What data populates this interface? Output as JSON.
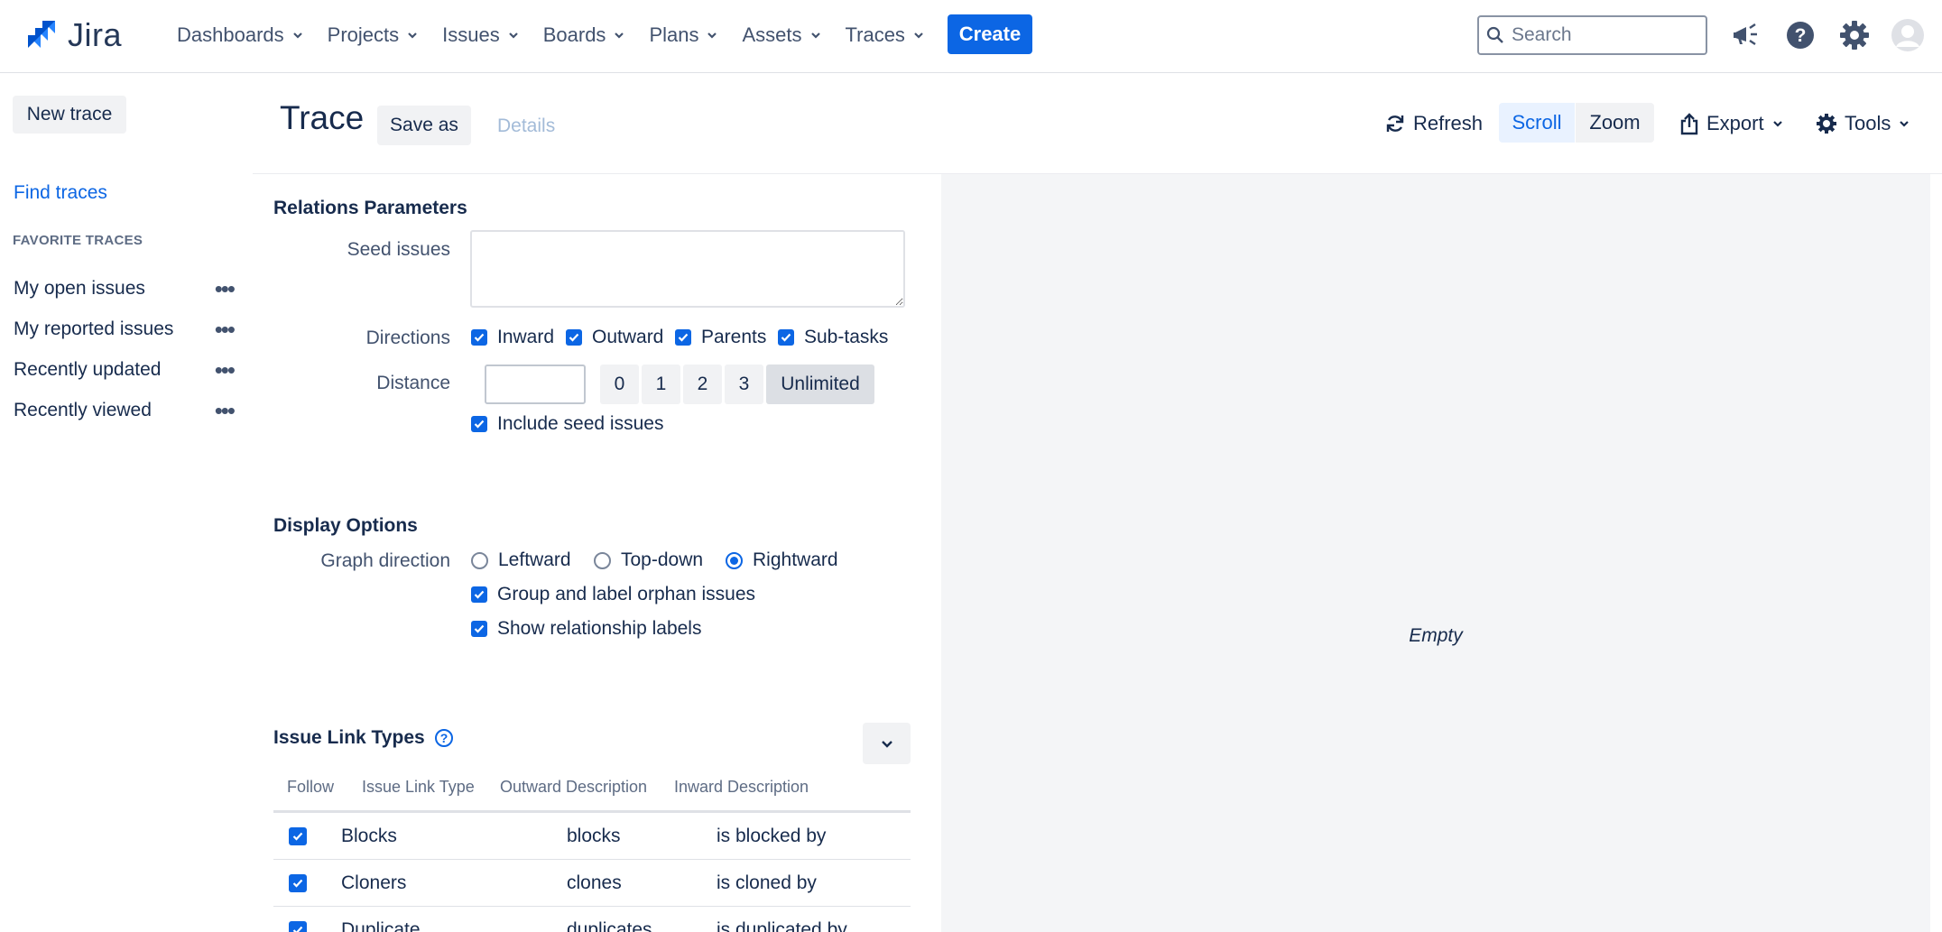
{
  "app": {
    "logo_text": "Jira"
  },
  "nav": {
    "items": [
      {
        "label": "Dashboards"
      },
      {
        "label": "Projects"
      },
      {
        "label": "Issues"
      },
      {
        "label": "Boards"
      },
      {
        "label": "Plans"
      },
      {
        "label": "Assets"
      },
      {
        "label": "Traces"
      }
    ],
    "create_label": "Create",
    "search_placeholder": "Search"
  },
  "sidebar": {
    "new_trace_label": "New trace",
    "find_traces_label": "Find traces",
    "favorites_header": "FAVORITE TRACES",
    "favorites": [
      {
        "label": "My open issues"
      },
      {
        "label": "My reported issues"
      },
      {
        "label": "Recently updated"
      },
      {
        "label": "Recently viewed"
      }
    ]
  },
  "header": {
    "title": "Trace",
    "save_as_label": "Save as",
    "details_label": "Details",
    "refresh_label": "Refresh",
    "scroll_label": "Scroll",
    "zoom_label": "Zoom",
    "export_label": "Export",
    "tools_label": "Tools"
  },
  "relations": {
    "section_title": "Relations Parameters",
    "seed_label": "Seed issues",
    "seed_value": "",
    "directions_label": "Directions",
    "directions": [
      {
        "label": "Inward",
        "checked": true
      },
      {
        "label": "Outward",
        "checked": true
      },
      {
        "label": "Parents",
        "checked": true
      },
      {
        "label": "Sub-tasks",
        "checked": true
      }
    ],
    "distance_label": "Distance",
    "distance_value": "",
    "distance_options": [
      "0",
      "1",
      "2",
      "3",
      "Unlimited"
    ],
    "distance_selected": "Unlimited",
    "include_seed_label": "Include seed issues",
    "include_seed_checked": true
  },
  "display": {
    "section_title": "Display Options",
    "graph_direction_label": "Graph direction",
    "graph_directions": [
      "Leftward",
      "Top-down",
      "Rightward"
    ],
    "graph_direction_selected": "Rightward",
    "group_orphans_label": "Group and label orphan issues",
    "show_labels_label": "Show relationship labels"
  },
  "link_types": {
    "section_title": "Issue Link Types",
    "columns": [
      "Follow",
      "Issue Link Type",
      "Outward Description",
      "Inward Description"
    ],
    "rows": [
      {
        "follow": true,
        "type": "Blocks",
        "outward": "blocks",
        "inward": "is blocked by"
      },
      {
        "follow": true,
        "type": "Cloners",
        "outward": "clones",
        "inward": "is cloned by"
      },
      {
        "follow": true,
        "type": "Duplicate",
        "outward": "duplicates",
        "inward": "is duplicated by"
      }
    ]
  },
  "canvas": {
    "empty_label": "Empty"
  },
  "colors": {
    "accent": "#0c66e4",
    "canvas_bg": "#f4f5f7",
    "button_bg": "#f1f2f4"
  }
}
